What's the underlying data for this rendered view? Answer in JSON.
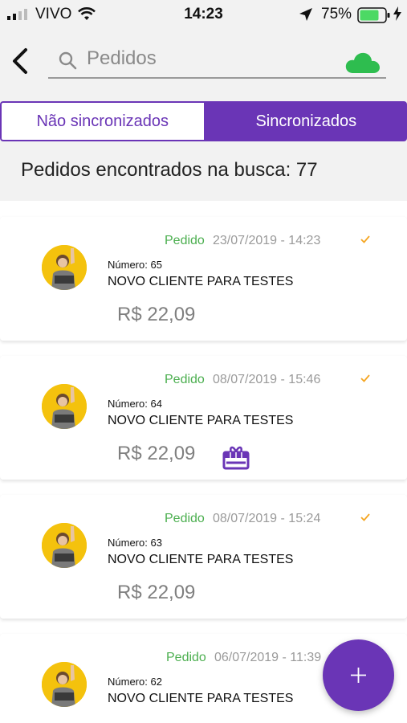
{
  "status_bar": {
    "carrier": "VIVO",
    "time": "14:23",
    "battery_percent": "75%"
  },
  "search": {
    "placeholder": "Pedidos",
    "value": ""
  },
  "tabs": [
    {
      "label": "Não sincronizados",
      "active": false
    },
    {
      "label": "Sincronizados",
      "active": true
    }
  ],
  "results_count": "Pedidos encontrados na busca: 77",
  "orders": [
    {
      "type": "Pedido",
      "datetime": "23/07/2019 - 14:23",
      "number": "Número: 65",
      "client": "NOVO CLIENTE PARA TESTES",
      "amount": "R$ 22,09",
      "gift": false
    },
    {
      "type": "Pedido",
      "datetime": "08/07/2019 - 15:46",
      "number": "Número: 64",
      "client": "NOVO CLIENTE PARA TESTES",
      "amount": "R$ 22,09",
      "gift": true
    },
    {
      "type": "Pedido",
      "datetime": "08/07/2019 - 15:24",
      "number": "Número: 63",
      "client": "NOVO CLIENTE PARA TESTES",
      "amount": "R$ 22,09",
      "gift": false
    },
    {
      "type": "Pedido",
      "datetime": "06/07/2019 - 11:39",
      "number": "Número: 62",
      "client": "NOVO CLIENTE PARA TESTES",
      "amount": "",
      "gift": false
    }
  ],
  "colors": {
    "accent": "#6a35b6",
    "status_green": "#4caf50",
    "check_orange": "#f5a623",
    "cloud_green": "#2ebd4f",
    "battery_green": "#4cd964"
  },
  "icons": {
    "back": "chevron-left-icon",
    "search": "magnifier-icon",
    "cloud": "cloud-icon",
    "check": "check-icon",
    "gift": "gift-icon",
    "fab": "plus-icon"
  }
}
